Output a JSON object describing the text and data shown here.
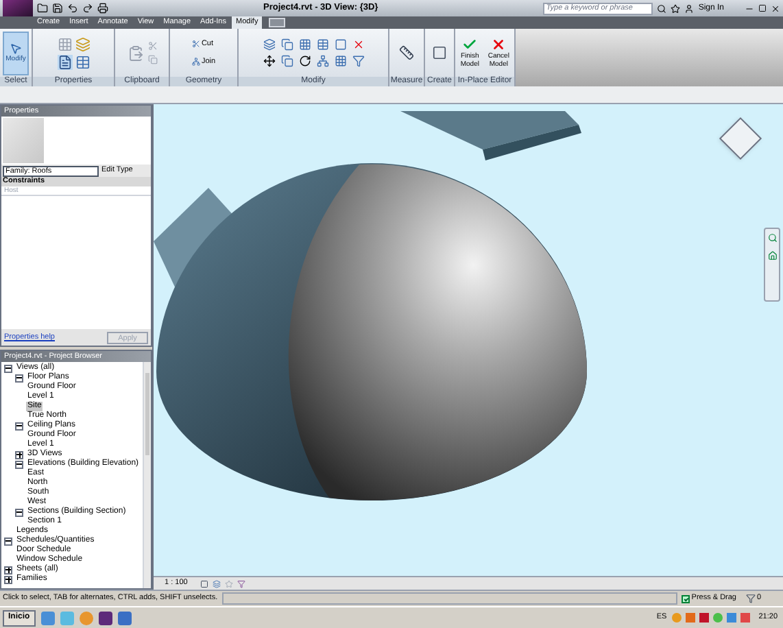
{
  "window": {
    "title": "Project4.rvt - 3D View: {3D}"
  },
  "search": {
    "placeholder": "Type a keyword or phrase"
  },
  "sign_in": "Sign In",
  "tabs": [
    {
      "label": "Create",
      "selected": false
    },
    {
      "label": "Insert",
      "selected": false
    },
    {
      "label": "Annotate",
      "selected": false
    },
    {
      "label": "View",
      "selected": false
    },
    {
      "label": "Manage",
      "selected": false
    },
    {
      "label": "Add-Ins",
      "selected": false
    },
    {
      "label": "Modify",
      "selected": true
    }
  ],
  "ribbon": {
    "select": {
      "button": "Modify",
      "label": "Select"
    },
    "properties": {
      "label": "Properties"
    },
    "clipboard": {
      "label": "Clipboard"
    },
    "geometry": {
      "cut": "Cut",
      "join": "Join",
      "label": "Geometry"
    },
    "modify": {
      "label": "Modify"
    },
    "measure": {
      "label": "Measure"
    },
    "create": {
      "label": "Create"
    },
    "in_place_editor": {
      "label": "In-Place Editor",
      "finish": "Finish Model",
      "cancel": "Cancel Model"
    }
  },
  "properties": {
    "title": "Properties",
    "type_selector": "Family: Roofs",
    "edit_type": "Edit Type",
    "group": "Constraints",
    "rows": [
      {
        "name": "Host",
        "disabled": true
      }
    ],
    "help": "Properties help",
    "apply": {
      "label": "Apply",
      "disabled": true
    }
  },
  "browser": {
    "title": "Project4.rvt - Project Browser",
    "tree": [
      {
        "label": "Views (all)",
        "expanded": true,
        "children": [
          {
            "label": "Floor Plans",
            "expanded": true,
            "children": [
              {
                "label": "Ground Floor",
                "selected": false
              },
              {
                "label": "Level 1",
                "selected": false
              },
              {
                "label": "Site",
                "selected": true
              },
              {
                "label": "True North",
                "selected": false
              }
            ]
          },
          {
            "label": "Ceiling Plans",
            "expanded": true,
            "children": [
              {
                "label": "Ground Floor",
                "selected": false
              },
              {
                "label": "Level 1",
                "selected": false
              }
            ]
          },
          {
            "label": "3D Views",
            "expanded": false
          },
          {
            "label": "Elevations (Building Elevation)",
            "expanded": true,
            "children": [
              {
                "label": "East",
                "selected": false
              },
              {
                "label": "North",
                "selected": false
              },
              {
                "label": "South",
                "selected": false
              },
              {
                "label": "West",
                "selected": false
              }
            ]
          },
          {
            "label": "Sections (Building Section)",
            "expanded": true,
            "children": [
              {
                "label": "Section 1",
                "selected": false
              }
            ]
          }
        ]
      },
      {
        "label": "Legends"
      },
      {
        "label": "Schedules/Quantities",
        "expanded": true,
        "children": [
          {
            "label": "Door Schedule",
            "selected": false
          },
          {
            "label": "Window Schedule",
            "selected": false
          }
        ]
      },
      {
        "label": "Sheets (all)",
        "expanded": false
      },
      {
        "label": "Families",
        "expanded": false
      }
    ]
  },
  "view_bar": {
    "scale": "1 : 100"
  },
  "status_bar": {
    "text": "Click to select, TAB for alternates, CTRL adds, SHIFT unselects.",
    "press_drag": {
      "label": "Press & Drag",
      "checked": true
    },
    "filter_count": "0"
  },
  "taskbar": {
    "start": "Inicio",
    "language": "ES",
    "clock": "21:20"
  }
}
